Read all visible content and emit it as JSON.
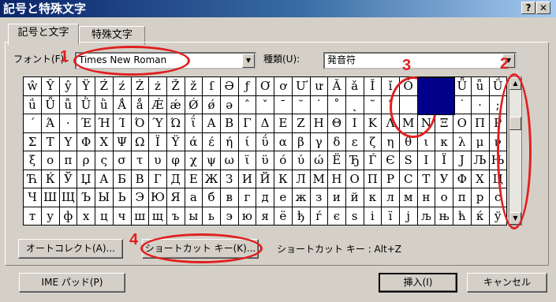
{
  "window": {
    "title": "記号と特殊文字",
    "help": "?",
    "close": "✕"
  },
  "tabs": [
    {
      "label": "記号と文字"
    },
    {
      "label": "特殊文字"
    }
  ],
  "font": {
    "label": "フォント(F):",
    "value": "Times New Roman"
  },
  "subset": {
    "label": "種類(U):",
    "value": "発音符"
  },
  "grid_rows": [
    [
      "ŵ",
      "Ŷ",
      "ŷ",
      "Ÿ",
      "Ź",
      "ź",
      "Ż",
      "ż",
      "Ž",
      "ž",
      "ſ",
      "Ə",
      "ƒ",
      "Ơ",
      "ơ",
      "Ư",
      "ư",
      "Ǎ",
      "ǎ",
      "Ǐ",
      "ǐ",
      "Ǒ",
      "",
      "ǔ",
      "Ǖ",
      "ǖ",
      "Ǘ"
    ],
    [
      "ǘ",
      "Ǚ",
      "ǚ",
      "Ǜ",
      "ǜ",
      "Ǻ",
      "ǻ",
      "Ǽ",
      "ǽ",
      "Ǿ",
      "ǿ",
      "ə",
      "ˆ",
      "ˇ",
      "ˉ",
      "˘",
      "˙",
      "˚",
      "˛",
      "˜",
      "˝",
      "",
      "",
      "",
      "˙",
      "·",
      ";"
    ],
    [
      "΄",
      "Ά",
      "·",
      "Έ",
      "Ή",
      "Ί",
      "Ό",
      "Ύ",
      "Ώ",
      "ΐ",
      "Α",
      "Β",
      "Γ",
      "Δ",
      "Ε",
      "Ζ",
      "Η",
      "Θ",
      "Ι",
      "Κ",
      "Λ",
      "Μ",
      "Ν",
      "Ξ",
      "Ο",
      "Π",
      "Ρ"
    ],
    [
      "Σ",
      "Τ",
      "Υ",
      "Φ",
      "Χ",
      "Ψ",
      "Ω",
      "Ϊ",
      "Ϋ",
      "ά",
      "έ",
      "ή",
      "ί",
      "ΰ",
      "α",
      "β",
      "γ",
      "δ",
      "ε",
      "ζ",
      "η",
      "θ",
      "ι",
      "κ",
      "λ",
      "μ",
      "ν"
    ],
    [
      "ξ",
      "ο",
      "π",
      "ρ",
      "ς",
      "σ",
      "τ",
      "υ",
      "φ",
      "χ",
      "ψ",
      "ω",
      "ϊ",
      "ϋ",
      "ό",
      "ύ",
      "ώ",
      "Ё",
      "Ђ",
      "Ѓ",
      "Є",
      "Ѕ",
      "І",
      "Ї",
      "Ј",
      "Љ",
      "Њ"
    ],
    [
      "Ћ",
      "Ќ",
      "Ў",
      "Џ",
      "А",
      "Б",
      "В",
      "Г",
      "Д",
      "Е",
      "Ж",
      "З",
      "И",
      "Й",
      "К",
      "Л",
      "М",
      "Н",
      "О",
      "П",
      "Р",
      "С",
      "Т",
      "У",
      "Ф",
      "Х",
      "Ц"
    ],
    [
      "Ч",
      "Ш",
      "Щ",
      "Ъ",
      "Ы",
      "Ь",
      "Э",
      "Ю",
      "Я",
      "а",
      "б",
      "в",
      "г",
      "д",
      "е",
      "ж",
      "з",
      "и",
      "й",
      "к",
      "л",
      "м",
      "н",
      "о",
      "п",
      "р",
      "с"
    ],
    [
      "т",
      "у",
      "ф",
      "х",
      "ц",
      "ч",
      "ш",
      "щ",
      "ъ",
      "ы",
      "ь",
      "э",
      "ю",
      "я",
      "ё",
      "ђ",
      "ѓ",
      "є",
      "ѕ",
      "і",
      "ї",
      "ј",
      "љ",
      "њ",
      "ћ",
      "ќ",
      "ў"
    ]
  ],
  "selected_cell": {
    "row": 0,
    "col": 22
  },
  "autocorrect_button": "オートコレクト(A)...",
  "shortcut_button": "ショートカット キー(K)...",
  "shortcut_info": "ショートカット キー : Alt+Z",
  "ime_button": "IME パッド(P)",
  "insert_button": "挿入(I)",
  "cancel_button": "キャンセル",
  "annotations": [
    "1",
    "2",
    "3",
    "4"
  ],
  "colors": {
    "selected": "#00008b",
    "annotation": "#e02020",
    "titlebar": "#0a246a"
  }
}
